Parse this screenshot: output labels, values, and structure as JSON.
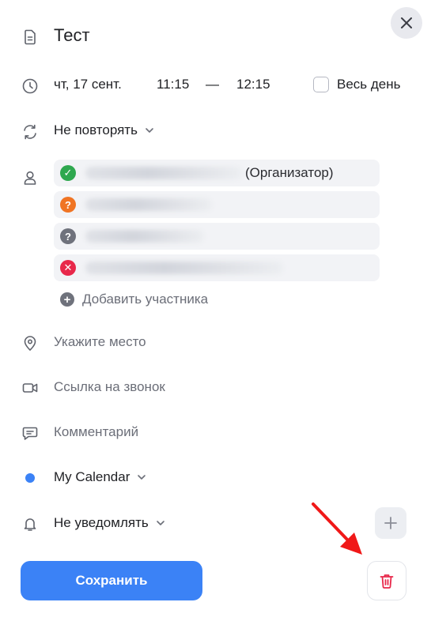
{
  "event": {
    "title": "Тест",
    "date": "чт, 17 сент.",
    "start_time": "11:15",
    "dash": "—",
    "end_time": "12:15",
    "all_day_label": "Весь день",
    "repeat": "Не повторять"
  },
  "participants": [
    {
      "status": "accepted",
      "status_symbol": "✓",
      "color": "#2fa84f",
      "role": "(Организатор)"
    },
    {
      "status": "maybe",
      "status_symbol": "?",
      "color": "#f07423",
      "role": ""
    },
    {
      "status": "unknown",
      "status_symbol": "?",
      "color": "#6f727c",
      "role": ""
    },
    {
      "status": "declined",
      "status_symbol": "✕",
      "color": "#e8284a",
      "role": ""
    }
  ],
  "add_participant_label": "Добавить участника",
  "location_placeholder": "Укажите место",
  "call_link_placeholder": "Ссылка на звонок",
  "comment_placeholder": "Комментарий",
  "calendar": {
    "name": "My Calendar",
    "color": "#3b82f6"
  },
  "notification": "Не уведомлять",
  "buttons": {
    "save": "Сохранить"
  },
  "colors": {
    "accent": "#3b82f6",
    "delete": "#e8284a",
    "annotation_arrow": "#f01818"
  }
}
